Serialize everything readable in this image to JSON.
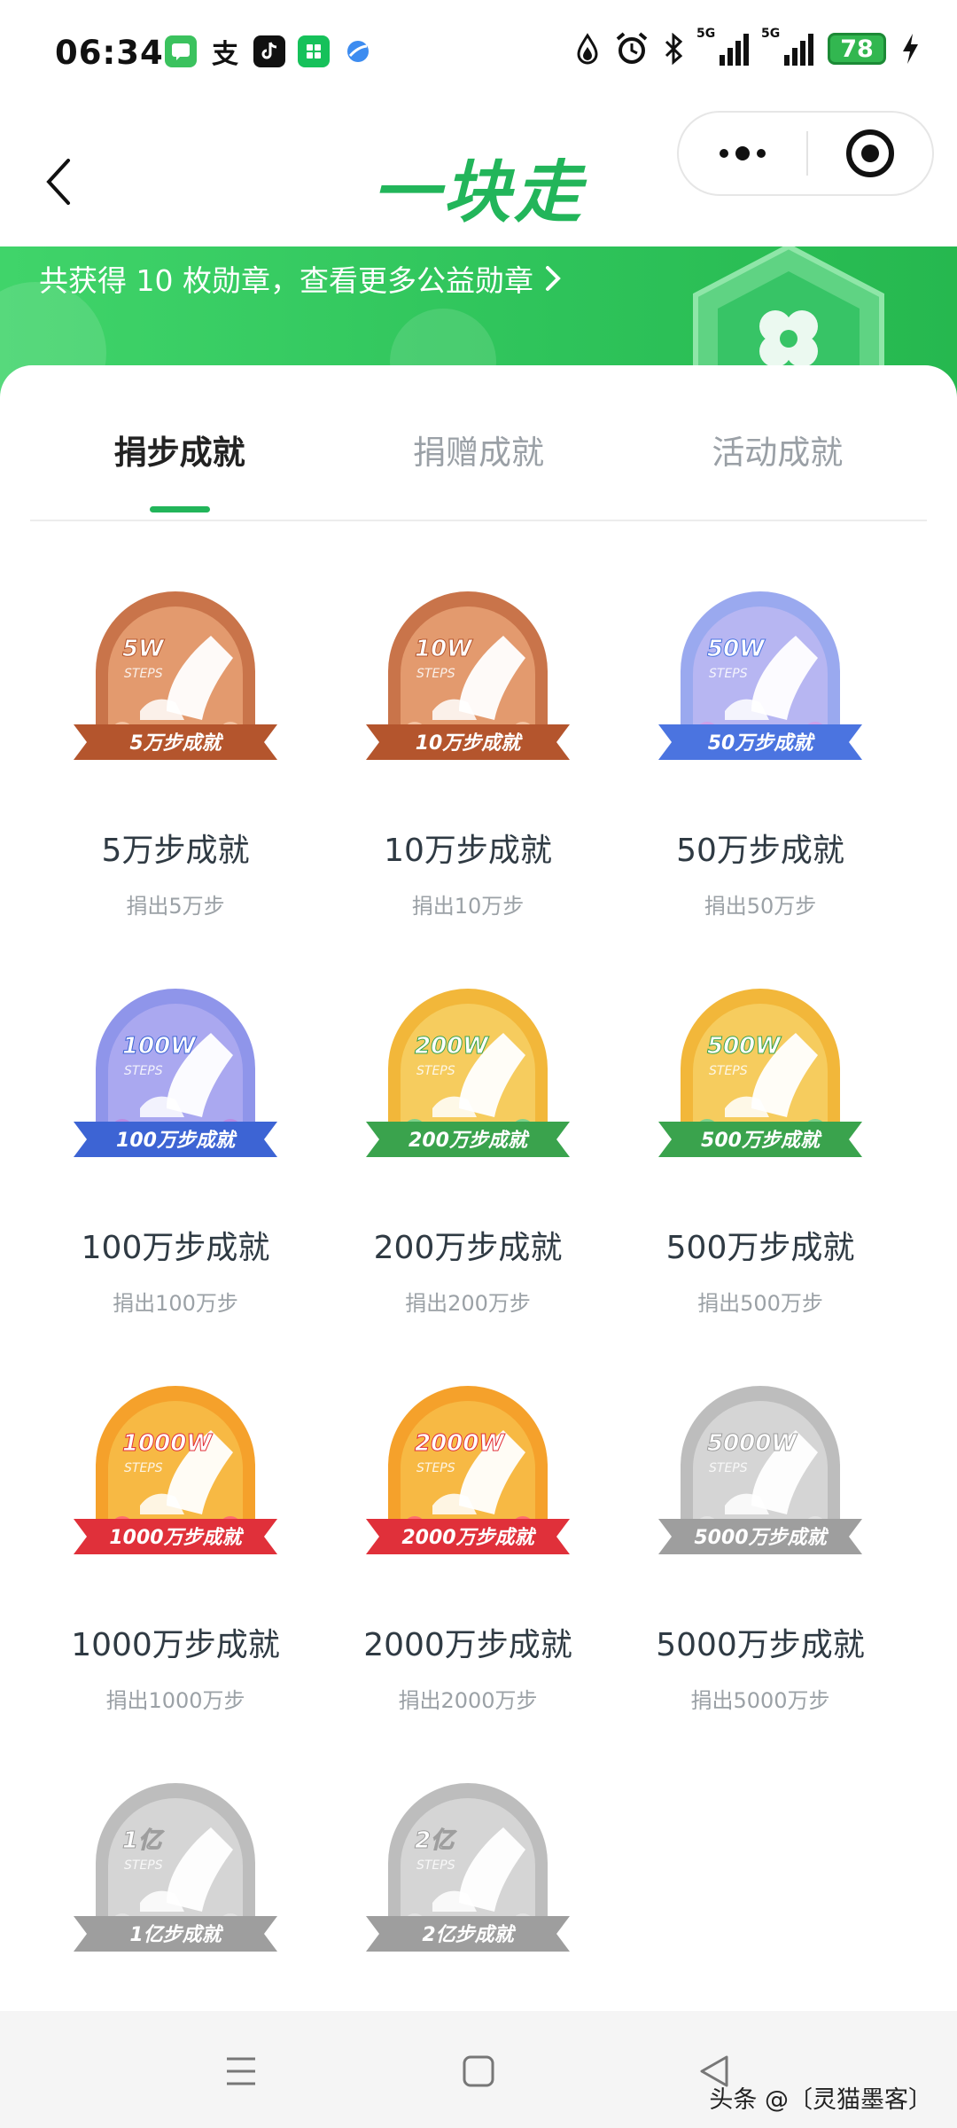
{
  "status_bar": {
    "time": "06:34",
    "app_icon_zhi": "支",
    "net1": "5G",
    "net2": "5G",
    "battery": "78"
  },
  "header": {
    "title": "一块走"
  },
  "banner": {
    "text": "共获得 10 枚勋章，查看更多公益勋章"
  },
  "tabs": [
    "捐步成就",
    "捐赠成就",
    "活动成就"
  ],
  "medals": [
    {
      "badge_top": "5W",
      "badge_sub": "STEPS",
      "ribbon": "5万步成就",
      "name": "5万步成就",
      "desc": "捐出5万步",
      "theme": "bronze"
    },
    {
      "badge_top": "10W",
      "badge_sub": "STEPS",
      "ribbon": "10万步成就",
      "name": "10万步成就",
      "desc": "捐出10万步",
      "theme": "bronze"
    },
    {
      "badge_top": "50W",
      "badge_sub": "STEPS",
      "ribbon": "50万步成就",
      "name": "50万步成就",
      "desc": "捐出50万步",
      "theme": "blue"
    },
    {
      "badge_top": "100W",
      "badge_sub": "STEPS",
      "ribbon": "100万步成就",
      "name": "100万步成就",
      "desc": "捐出100万步",
      "theme": "violet"
    },
    {
      "badge_top": "200W",
      "badge_sub": "STEPS",
      "ribbon": "200万步成就",
      "name": "200万步成就",
      "desc": "捐出200万步",
      "theme": "gold"
    },
    {
      "badge_top": "500W",
      "badge_sub": "STEPS",
      "ribbon": "500万步成就",
      "name": "500万步成就",
      "desc": "捐出500万步",
      "theme": "gold"
    },
    {
      "badge_top": "1000W",
      "badge_sub": "STEPS",
      "ribbon": "1000万步成就",
      "name": "1000万步成就",
      "desc": "捐出1000万步",
      "theme": "red"
    },
    {
      "badge_top": "2000W",
      "badge_sub": "STEPS",
      "ribbon": "2000万步成就",
      "name": "2000万步成就",
      "desc": "捐出2000万步",
      "theme": "red"
    },
    {
      "badge_top": "5000W",
      "badge_sub": "STEPS",
      "ribbon": "5000万步成就",
      "name": "5000万步成就",
      "desc": "捐出5000万步",
      "theme": "gray"
    },
    {
      "badge_top": "1亿",
      "badge_sub": "STEPS",
      "ribbon": "1亿步成就",
      "theme": "gray"
    },
    {
      "badge_top": "2亿",
      "badge_sub": "STEPS",
      "ribbon": "2亿步成就",
      "theme": "gray"
    }
  ],
  "themes": {
    "bronze": {
      "outer": "#c9744a",
      "inner": "#e39a6e",
      "ribbon": "#b4552d",
      "accent": "#f4c2a0"
    },
    "blue": {
      "outer": "#9aa9ef",
      "inner": "#b7b6f2",
      "ribbon": "#4b74e0",
      "accent": "#cda0e8"
    },
    "violet": {
      "outer": "#8f95ea",
      "inner": "#aaa8f0",
      "ribbon": "#3d64d4",
      "accent": "#b98ae0"
    },
    "gold": {
      "outer": "#f2b73a",
      "inner": "#f6cc5e",
      "ribbon": "#3aa34d",
      "accent": "#7fd08b"
    },
    "red": {
      "outer": "#f5a12b",
      "inner": "#f7b944",
      "ribbon": "#e0303a",
      "accent": "#ff6e6e"
    },
    "gray": {
      "outer": "#bdbdbd",
      "inner": "#d5d5d5",
      "ribbon": "#9e9e9e",
      "accent": "#e2e2e2"
    }
  },
  "watermark": "头条 @〔灵猫墨客〕"
}
